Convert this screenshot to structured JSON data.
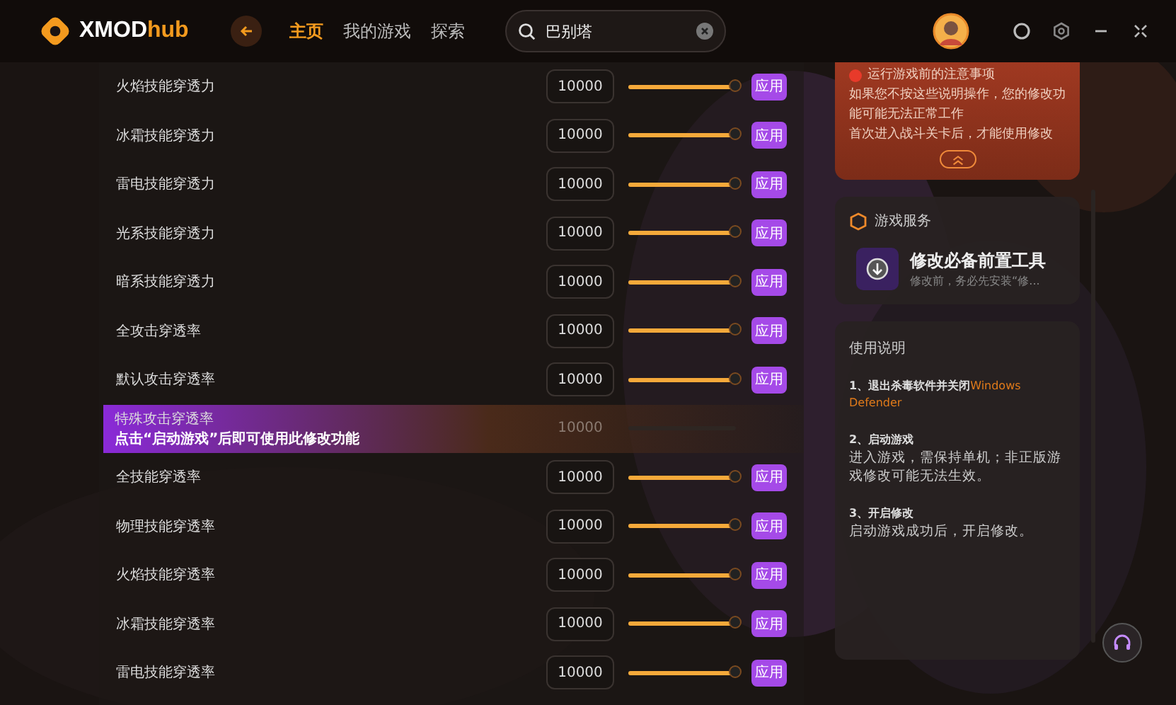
{
  "header": {
    "logo": {
      "name_main": "XMOD",
      "name_accent": "hub"
    },
    "nav": [
      {
        "label": "主页",
        "selected": true
      },
      {
        "label": "我的游戏",
        "selected": false
      },
      {
        "label": "探索",
        "selected": false
      }
    ],
    "search": {
      "value": "巴别塔"
    }
  },
  "settings": [
    {
      "kind": "slider",
      "label": "火焰技能穿透力",
      "value": "10000",
      "level": 1,
      "button": "应用"
    },
    {
      "kind": "slider",
      "label": "冰霜技能穿透力",
      "value": "10000",
      "level": 1,
      "button": "应用"
    },
    {
      "kind": "slider",
      "label": "雷电技能穿透力",
      "value": "10000",
      "level": 1,
      "button": "应用"
    },
    {
      "kind": "slider",
      "label": "光系技能穿透力",
      "value": "10000",
      "level": 1,
      "button": "应用"
    },
    {
      "kind": "slider",
      "label": "暗系技能穿透力",
      "value": "10000",
      "level": 1,
      "button": "应用"
    },
    {
      "kind": "slider",
      "label": "全攻击穿透率",
      "value": "10000",
      "level": 1,
      "button": "应用"
    },
    {
      "kind": "slider",
      "label": "默认攻击穿透率",
      "value": "10000",
      "level": 1,
      "button": "应用"
    },
    {
      "kind": "locked",
      "label": "特殊攻击穿透率",
      "hint": "点击“启动游戏”后即可使用此修改功能",
      "value": "10000",
      "level": 1
    },
    {
      "kind": "slider",
      "label": "全技能穿透率",
      "value": "10000",
      "level": 1,
      "button": "应用"
    },
    {
      "kind": "slider",
      "label": "物理技能穿透率",
      "value": "10000",
      "level": 1,
      "button": "应用"
    },
    {
      "kind": "slider",
      "label": "火焰技能穿透率",
      "value": "10000",
      "level": 1,
      "button": "应用"
    },
    {
      "kind": "slider",
      "label": "冰霜技能穿透率",
      "value": "10000",
      "level": 1,
      "button": "应用"
    },
    {
      "kind": "slider",
      "label": "雷电技能穿透率",
      "value": "10000",
      "level": 1,
      "button": "应用"
    }
  ],
  "notice": {
    "title": "运行游戏前的注意事项",
    "lines": [
      "如果您不按这些说明操作，您的修改功能可能无法正常工作",
      "首次进入战斗关卡后，才能使用修改"
    ]
  },
  "service": {
    "title": "游戏服务",
    "item": {
      "name": "修改必备前置工具",
      "desc": "修改前，务必先安装“修..."
    }
  },
  "instructions": {
    "title": "使用说明",
    "steps": [
      {
        "title": "1、退出杀毒软件并关闭",
        "highlight": "Windows Defender"
      },
      {
        "title": "2、启动游戏",
        "text": "进入游戏，需保持单机；非正版游戏修改可能无法生效。"
      },
      {
        "title": "3、开启修改",
        "text": "启动游戏成功后，开启修改。"
      }
    ]
  }
}
